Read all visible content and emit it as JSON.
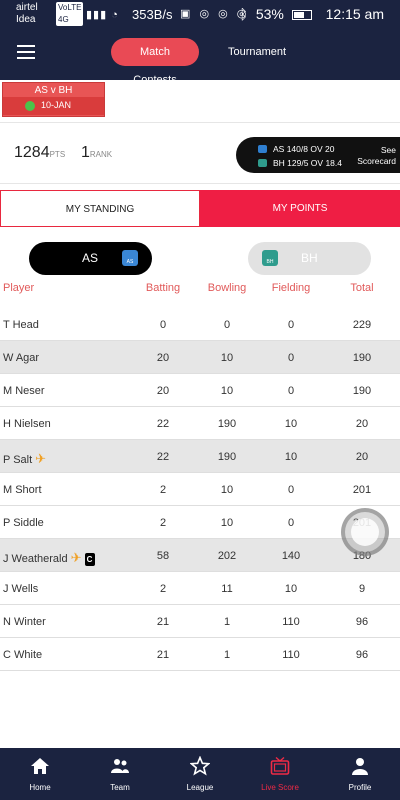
{
  "status": {
    "carrier_line1": "airtel",
    "carrier_badge": "VoLTE 4G",
    "carrier_line2": "Idea",
    "speed": "353B/s",
    "battery": "53%",
    "time": "12:15 am"
  },
  "appbar": {
    "tab_active": "Match Contests",
    "tab_other": "Tournament"
  },
  "match": {
    "teams": "AS v BH",
    "date": "10-JAN"
  },
  "summary": {
    "points": "1284",
    "points_unit": "PTS",
    "rank": "1",
    "rank_unit": "RANK"
  },
  "score": {
    "line1": "AS 140/8 OV 20",
    "line2": "BH 129/5 OV 18.4",
    "see_line1": "See",
    "see_line2": "Scorecard"
  },
  "segments": {
    "standing": "MY STANDING",
    "points": "MY POINTS"
  },
  "teams": {
    "left": "AS",
    "left_badge": "AS",
    "right": "BH",
    "right_badge": "BH"
  },
  "table": {
    "headers": {
      "player": "Player",
      "batting": "Batting",
      "bowling": "Bowling",
      "fielding": "Fielding",
      "total": "Total"
    },
    "rows": [
      {
        "player": "T Head",
        "batting": "0",
        "bowling": "0",
        "fielding": "0",
        "total": "229"
      },
      {
        "player": "W Agar",
        "batting": "20",
        "bowling": "10",
        "fielding": "0",
        "total": "190"
      },
      {
        "player": "M Neser",
        "batting": "20",
        "bowling": "10",
        "fielding": "0",
        "total": "190"
      },
      {
        "player": "H Nielsen",
        "batting": "22",
        "bowling": "190",
        "fielding": "10",
        "total": "20"
      },
      {
        "player": "P Salt",
        "batting": "22",
        "bowling": "190",
        "fielding": "10",
        "total": "20"
      },
      {
        "player": "M Short",
        "batting": "2",
        "bowling": "10",
        "fielding": "0",
        "total": "201"
      },
      {
        "player": "P Siddle",
        "batting": "2",
        "bowling": "10",
        "fielding": "0",
        "total": "201"
      },
      {
        "player": "J Weatherald",
        "batting": "58",
        "bowling": "202",
        "fielding": "140",
        "total": "180",
        "captain_badge": "C"
      },
      {
        "player": "J Wells",
        "batting": "2",
        "bowling": "11",
        "fielding": "10",
        "total": "9"
      },
      {
        "player": "N Winter",
        "batting": "21",
        "bowling": "1",
        "fielding": "110",
        "total": "96"
      },
      {
        "player": "C White",
        "batting": "21",
        "bowling": "1",
        "fielding": "110",
        "total": "96"
      }
    ]
  },
  "nav": {
    "home": "Home",
    "team": "Team",
    "league": "League",
    "live": "Live Score",
    "profile": "Profile"
  },
  "colors": {
    "navy": "#1b2340",
    "accent": "#ef1e44",
    "pill": "#e94a55",
    "header_text": "#e15a5a"
  }
}
